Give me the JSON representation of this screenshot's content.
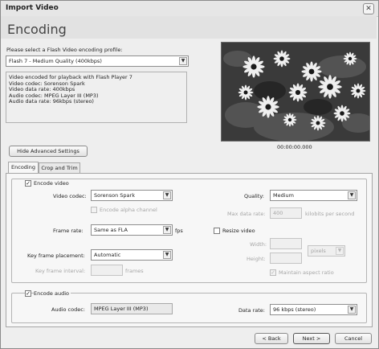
{
  "window": {
    "title": "Import Video"
  },
  "header": {
    "heading": "Encoding"
  },
  "profile": {
    "prompt": "Please select a Flash Video encoding profile:",
    "selected": "Flash 7 - Medium Quality (400kbps)",
    "description": [
      "Video encoded for playback with Flash Player 7",
      "Video codec: Sorenson Spark",
      "Video data rate: 400kbps",
      "Audio codec: MPEG Layer III (MP3)",
      "Audio data rate: 96kbps (stereo)"
    ]
  },
  "preview": {
    "timecode": "00:00:00.000"
  },
  "advanced_button": "Hide Advanced Settings",
  "tabs": [
    {
      "label": "Encoding",
      "active": true
    },
    {
      "label": "Crop and Trim",
      "active": false
    }
  ],
  "video": {
    "encode_label": "Encode video",
    "encode_checked": true,
    "codec_label": "Video codec:",
    "codec_value": "Sorenson Spark",
    "alpha_label": "Encode alpha channel",
    "quality_label": "Quality:",
    "quality_value": "Medium",
    "max_rate_label": "Max data rate:",
    "max_rate_value": "400",
    "max_rate_unit": "kilobits per second",
    "frame_rate_label": "Frame rate:",
    "frame_rate_value": "Same as FLA",
    "frame_rate_unit": "fps",
    "keyframe_placement_label": "Key frame placement:",
    "keyframe_placement_value": "Automatic",
    "keyframe_interval_label": "Key frame interval:",
    "keyframe_interval_unit": "frames",
    "resize_label": "Resize video",
    "width_label": "Width:",
    "height_label": "Height:",
    "size_unit": "pixels",
    "aspect_label": "Maintain aspect ratio"
  },
  "audio": {
    "encode_label": "Encode audio",
    "encode_checked": true,
    "codec_label": "Audio codec:",
    "codec_value": "MPEG Layer III (MP3)",
    "rate_label": "Data rate:",
    "rate_value": "96 kbps (stereo)"
  },
  "footer": {
    "back": "< Back",
    "next": "Next >",
    "cancel": "Cancel"
  },
  "icons": {
    "close": "close-icon",
    "dropdown": "chevron-down-icon",
    "check": "checkmark-icon"
  }
}
